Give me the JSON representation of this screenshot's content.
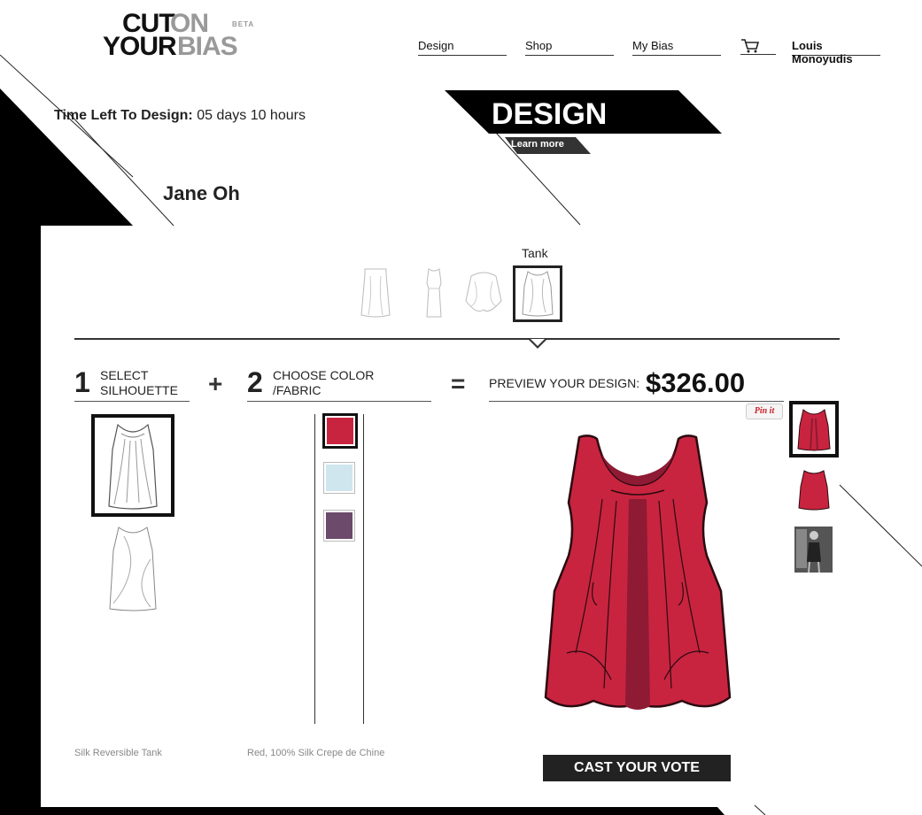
{
  "header": {
    "logo_words": [
      "CUT",
      "ON",
      "YOUR",
      "BIAS"
    ],
    "logo_badge": "BETA",
    "nav": [
      {
        "label": "Design"
      },
      {
        "label": "Shop"
      },
      {
        "label": "My Bias"
      }
    ],
    "cart_icon": "shopping-cart-icon",
    "user_name": "Louis Monoyudis"
  },
  "time_left": {
    "label": "Time Left To Design:",
    "value": "05 days 10 hours"
  },
  "banner": {
    "title": "DESIGN",
    "link": "Learn more"
  },
  "designer_name": "Jane Oh",
  "silhouette_picker": {
    "selected_label": "Tank"
  },
  "steps": {
    "step1": {
      "number": "1",
      "line1": "SELECT",
      "line2": "SILHOUETTE"
    },
    "plus": "+",
    "step2": {
      "number": "2",
      "line1": "CHOOSE COLOR",
      "line2": "/FABRIC"
    },
    "equals": "=",
    "preview_label": "PREVIEW YOUR DESIGN:",
    "price": "$326.00"
  },
  "swatches": [
    {
      "name": "red",
      "color": "#c8243f"
    },
    {
      "name": "light-blue",
      "color": "#cfe6ee"
    },
    {
      "name": "plum",
      "color": "#6b4a6b"
    }
  ],
  "pin_label": "Pin it",
  "captions": {
    "silhouette": "Silk Reversible Tank",
    "fabric": "Red, 100% Silk Crepe de Chine"
  },
  "vote_button": "CAST YOUR VOTE",
  "colors": {
    "garment_red": "#c8243f",
    "garment_shadow": "#8e1a34",
    "dark": "#111111"
  }
}
